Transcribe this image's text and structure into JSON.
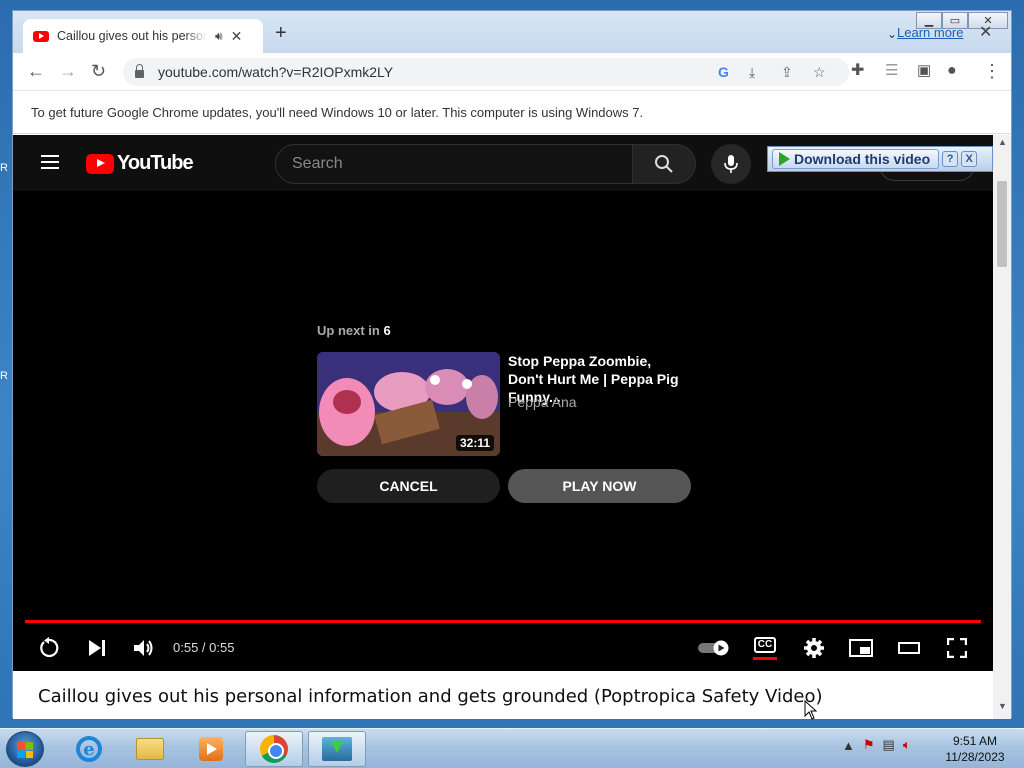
{
  "browser": {
    "tab_title": "Caillou gives out his personal information and gets grounded (Poptropica Safety Video)",
    "new_tab": "+",
    "url": "youtube.com/watch?v=R2IOPxmk2LY",
    "infobar_text": "To get future Google Chrome updates, you'll need Windows 10 or later. This computer is using Windows 7.",
    "infobar_link": "Learn more"
  },
  "youtube": {
    "logo_text": "YouTube",
    "search_placeholder": "Search"
  },
  "download_bar": {
    "label": "Download this video",
    "help": "?",
    "close": "X"
  },
  "up_next": {
    "prefix": "Up next in",
    "countdown": "6",
    "title": "Stop Peppa Zoombie, Don't Hurt Me | Peppa Pig Funny...",
    "channel": "Peppa Ana",
    "duration": "32:11",
    "cancel_label": "CANCEL",
    "play_label": "PLAY NOW"
  },
  "player": {
    "time": "0:55 / 0:55",
    "progress": 1.0,
    "cc_label": "CC"
  },
  "video": {
    "title": "Caillou gives out his personal information and gets grounded (Poptropica Safety Video)"
  },
  "taskbar": {
    "time": "9:51 AM",
    "date": "11/28/2023"
  },
  "colors": {
    "youtube_red": "#ff0000",
    "page_bg": "#000000",
    "link_blue": "#1a5fb4"
  }
}
